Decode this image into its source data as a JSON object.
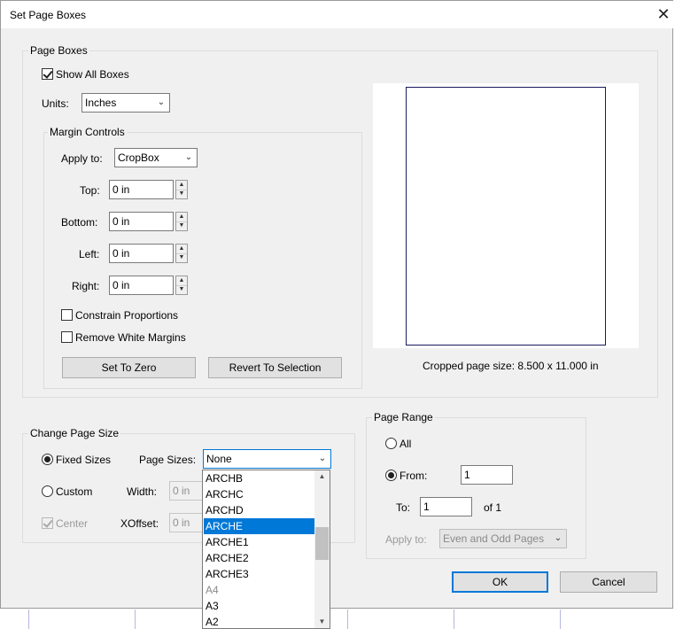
{
  "window": {
    "title": "Set Page Boxes",
    "close_glyph": "✕"
  },
  "page_boxes": {
    "legend": "Page Boxes",
    "show_all_boxes": {
      "label": "Show All Boxes",
      "checked": true
    },
    "units": {
      "label": "Units:",
      "value": "Inches"
    },
    "margin_controls": {
      "legend": "Margin Controls",
      "apply_to": {
        "label": "Apply to:",
        "value": "CropBox"
      },
      "top": {
        "label": "Top:",
        "value": "0 in"
      },
      "bottom": {
        "label": "Bottom:",
        "value": "0 in"
      },
      "left": {
        "label": "Left:",
        "value": "0 in"
      },
      "right": {
        "label": "Right:",
        "value": "0 in"
      },
      "constrain_proportions": {
        "label": "Constrain Proportions",
        "checked": false
      },
      "remove_white_margins": {
        "label": "Remove White Margins",
        "checked": false
      },
      "set_to_zero": "Set To Zero",
      "revert_to_selection": "Revert To Selection"
    },
    "cropped_size": "Cropped page size: 8.500 x 11.000 in"
  },
  "change_page_size": {
    "legend": "Change Page Size",
    "fixed_sizes": {
      "label": "Fixed Sizes",
      "checked": true
    },
    "page_sizes": {
      "label": "Page Sizes:",
      "value": "None"
    },
    "custom": {
      "label": "Custom",
      "checked": false
    },
    "width": {
      "label": "Width:",
      "value": "0 in"
    },
    "center": {
      "label": "Center",
      "checked": true
    },
    "xoffset": {
      "label": "XOffset:",
      "value": "0 in"
    },
    "dropdown_items": [
      "ARCHB",
      "ARCHC",
      "ARCHD",
      "ARCHE",
      "ARCHE1",
      "ARCHE2",
      "ARCHE3",
      "A4",
      "A3",
      "A2"
    ],
    "dropdown_selected": "ARCHE"
  },
  "page_range": {
    "legend": "Page Range",
    "all": {
      "label": "All",
      "checked": false
    },
    "from": {
      "label": "From:",
      "value": "1",
      "checked": true
    },
    "to": {
      "label": "To:",
      "value": "1"
    },
    "of_text": "of 1",
    "apply_to": {
      "label": "Apply to:",
      "value": "Even and Odd Pages"
    }
  },
  "buttons": {
    "ok": "OK",
    "cancel": "Cancel"
  }
}
